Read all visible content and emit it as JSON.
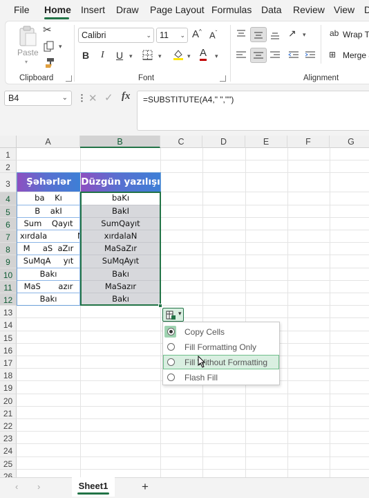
{
  "menu": {
    "items": [
      "File",
      "Home",
      "Insert",
      "Draw",
      "Page Layout",
      "Formulas",
      "Data",
      "Review",
      "View",
      "D"
    ],
    "active": "Home"
  },
  "ribbon": {
    "clipboard": {
      "paste_label": "Paste",
      "group_label": "Clipboard"
    },
    "font": {
      "font_name": "Calibri",
      "font_size": "11",
      "group_label": "Font",
      "bold": "B",
      "italic": "I",
      "underline": "U"
    },
    "alignment": {
      "wrap_text": "Wrap Te",
      "merge": "Merge &",
      "group_label": "Alignment"
    },
    "colors": {
      "highlight": "#ffe600",
      "font_color": "#c00000"
    }
  },
  "formula_bar": {
    "name_box": "B4",
    "fx": "fx",
    "formula": "=SUBSTITUTE(A4,\" \",\"\")"
  },
  "grid": {
    "columns": [
      "A",
      "B",
      "C",
      "D",
      "E",
      "F",
      "G"
    ],
    "selected_column": "B",
    "rows": [
      "1",
      "2",
      "3",
      "4",
      "5",
      "6",
      "7",
      "8",
      "9",
      "10",
      "11",
      "12",
      "13",
      "14",
      "15",
      "16",
      "17",
      "18",
      "19",
      "20",
      "21",
      "22",
      "23",
      "24",
      "25",
      "26"
    ],
    "header_a": "Şəhərlər",
    "header_b": "Düzgün yazılışı",
    "col_a": [
      "ba    Kı",
      "B    akI",
      "Sum    Qayıt",
      "xırdala            N",
      "M     aS  aZır",
      "SuMqA     yıt",
      "Bakı",
      "MaS       azır",
      "Bakı"
    ],
    "col_b": [
      "baKı",
      "BakI",
      "SumQayıt",
      "xırdalaN",
      "MaSaZır",
      "SuMqAyıt",
      "Bakı",
      "MaSazır",
      "Bakı"
    ]
  },
  "autofill": {
    "options": [
      "Copy Cells",
      "Fill Formatting Only",
      "Fill Without Formatting",
      "Flash Fill"
    ],
    "selected": "Copy Cells",
    "hovered": "Fill Without Formatting"
  },
  "sheets": {
    "tabs": [
      "Sheet1"
    ],
    "add": "+"
  }
}
